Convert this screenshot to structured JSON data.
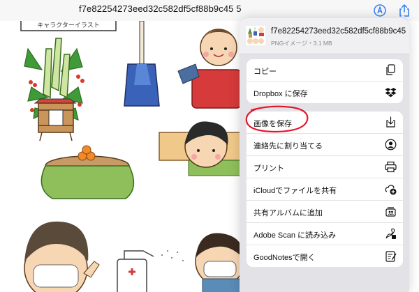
{
  "toolbar": {
    "title": "f7e82254273eed32c582df5cf88b9c45 5",
    "icons": [
      "markup-icon",
      "share-icon"
    ]
  },
  "image": {
    "banner_text": "キャラクターイラスト"
  },
  "share_sheet": {
    "file_name": "f7e82254273eed32c582df5cf88b9c45",
    "file_meta": "PNGイメージ・3.1 MB",
    "group1": [
      {
        "label": "コピー",
        "icon": "copy-icon"
      },
      {
        "label": "Dropbox に保存",
        "icon": "dropbox-icon"
      }
    ],
    "group2": [
      {
        "label": "画像を保存",
        "icon": "save-image-icon"
      },
      {
        "label": "連絡先に割り当てる",
        "icon": "contact-icon"
      },
      {
        "label": "プリント",
        "icon": "printer-icon"
      },
      {
        "label": "iCloudでファイルを共有",
        "icon": "icloud-share-icon"
      },
      {
        "label": "共有アルバムに追加",
        "icon": "shared-album-icon"
      },
      {
        "label": "Adobe Scan に読み込み",
        "icon": "adobe-scan-icon"
      },
      {
        "label": "GoodNotesで開く",
        "icon": "goodnotes-icon"
      }
    ]
  },
  "colors": {
    "accent": "#2f7bf6",
    "highlight": "#e4162c"
  }
}
